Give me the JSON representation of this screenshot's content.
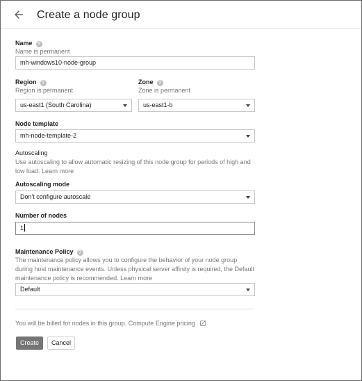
{
  "header": {
    "title": "Create a node group"
  },
  "name": {
    "label": "Name",
    "hint": "Name is permanent",
    "value": "mh-windows10-node-group"
  },
  "region": {
    "label": "Region",
    "hint": "Region is permanent",
    "value": "us-east1 (South Carolina)"
  },
  "zone": {
    "label": "Zone",
    "hint": "Zone is permanent",
    "value": "us-east1-b"
  },
  "node_template": {
    "label": "Node template",
    "value": "mh-node-template-2"
  },
  "autoscaling": {
    "heading": "Autoscaling",
    "description": "Use autoscaling to allow automatic resizing of this node group for periods of high and low load.",
    "learn_more": "Learn more"
  },
  "autoscaling_mode": {
    "label": "Autoscaling mode",
    "value": "Don't configure autoscale"
  },
  "number_of_nodes": {
    "label": "Number of nodes",
    "value": "1"
  },
  "maintenance": {
    "label": "Maintenance Policy",
    "description": "The maintenance policy allows you to configure the behavior of your node group during host maintenance events. Unless physical server affinity is required, the Default maintenance policy is recommended.",
    "learn_more": "Learn more",
    "value": "Default"
  },
  "billing": {
    "text": "You will be billed for nodes in this group.",
    "link": "Compute Engine pricing"
  },
  "actions": {
    "create": "Create",
    "cancel": "Cancel"
  },
  "icons": {
    "back": "arrow-back-icon",
    "help": "help-icon",
    "dropdown": "dropdown-caret-icon",
    "external": "open-in-new-icon"
  }
}
